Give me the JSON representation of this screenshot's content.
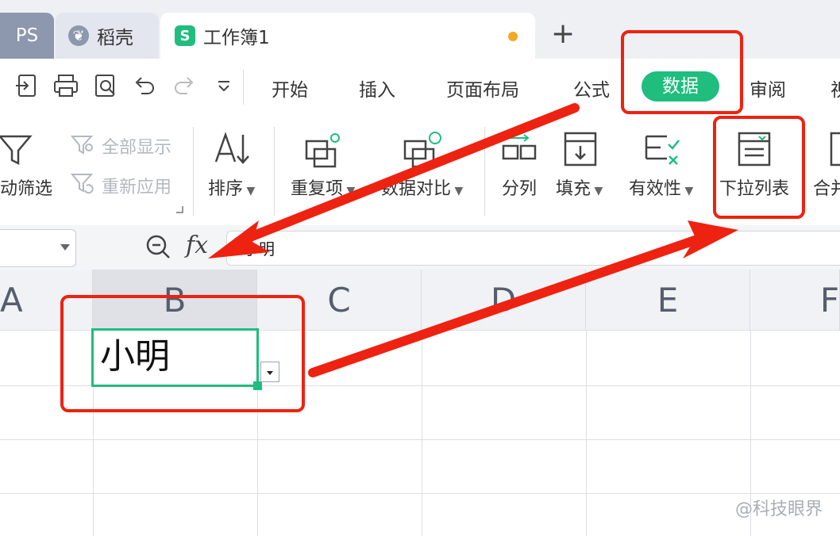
{
  "tabs": [
    {
      "label": "PS",
      "active": false
    },
    {
      "label": "稻壳",
      "active": false
    },
    {
      "label": "工作簿1",
      "active": true
    }
  ],
  "menu": [
    "开始",
    "插入",
    "页面布局",
    "公式",
    "数据",
    "审阅",
    "视"
  ],
  "active_menu": "数据",
  "toolbar": {
    "auto_filter": "动筛选",
    "show_all": "全部显示",
    "reapply": "重新应用",
    "sort": "排序",
    "duplicates": "重复项",
    "compare": "数据对比",
    "split": "分列",
    "fill": "填充",
    "validity": "有效性",
    "dropdown_list": "下拉列表",
    "merge": "合并"
  },
  "formula": {
    "fx": "fx",
    "value": "小明"
  },
  "columns": [
    "A",
    "B",
    "C",
    "D",
    "E",
    "F"
  ],
  "cell_b2": "小明",
  "watermark": "@科技眼界",
  "colors": {
    "accent": "#1fbd7e",
    "annotation": "#ee2211"
  }
}
